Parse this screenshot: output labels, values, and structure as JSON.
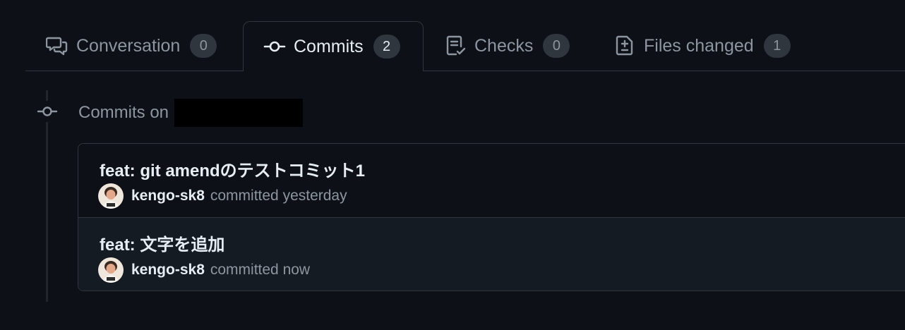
{
  "tabs": [
    {
      "label": "Conversation",
      "count": "0",
      "icon": "comment-discussion-icon",
      "active": false
    },
    {
      "label": "Commits",
      "count": "2",
      "icon": "git-commit-icon",
      "active": true
    },
    {
      "label": "Checks",
      "count": "0",
      "icon": "checklist-icon",
      "active": false
    },
    {
      "label": "Files changed",
      "count": "1",
      "icon": "file-diff-icon",
      "active": false
    }
  ],
  "timeline": {
    "heading": "Commits on",
    "icon": "git-commit-icon"
  },
  "commits": [
    {
      "title": "feat: git amendのテストコミット1",
      "author": "kengo-sk8",
      "action": "committed yesterday"
    },
    {
      "title": "feat: 文字を追加",
      "author": "kengo-sk8",
      "action": "committed now"
    }
  ],
  "colors": {
    "background": "#0d1117",
    "border": "#30363d",
    "text_primary": "#e6edf3",
    "text_muted": "#8d96a0",
    "counter_bg": "#30363d"
  }
}
